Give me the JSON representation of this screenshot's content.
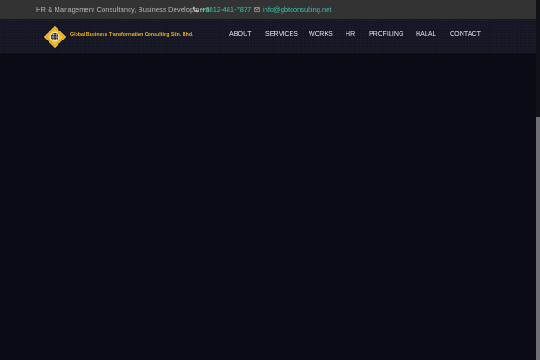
{
  "topbar": {
    "tagline": "HR & Management Consultancy, Business Development",
    "phone": "+6012-481-7877",
    "email": "info@gbtconsulting.net",
    "phone_icon": "phone-icon",
    "email_icon": "envelope-icon",
    "link_color": "#2ec8b4"
  },
  "header": {
    "brand_name": "Global Business Transformation Consulting Sdn. Bhd.",
    "brand_color": "#f0b419",
    "logo_icon": "globe-diamond-logo"
  },
  "nav": {
    "about": "ABOUT",
    "services": "SERVICES",
    "works": "WORKS",
    "hr": "HR",
    "profiling": "PROFILING",
    "halal": "HALAL",
    "contact": "CONTACT"
  },
  "colors": {
    "topbar_bg": "#333333",
    "nav_bg": "#171825",
    "page_bg": "#0b0b16"
  }
}
